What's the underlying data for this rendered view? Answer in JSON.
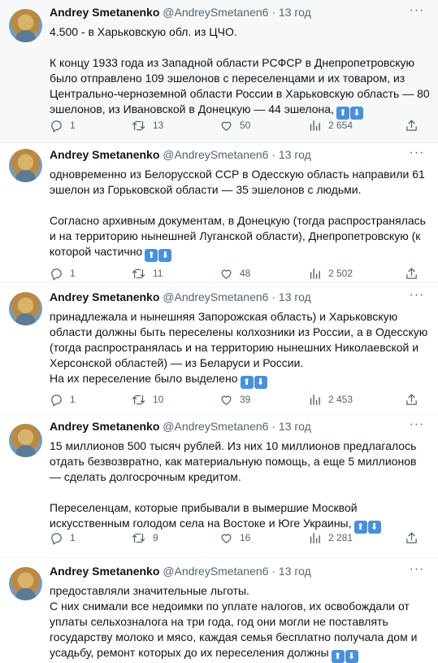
{
  "author": {
    "name": "Andrey Smetanenko",
    "handle": "@AndreySmetanen6"
  },
  "tweets": [
    {
      "time": "13 год",
      "paragraphs": [
        "4.500 - в Харьковскую обл. из ЦЧО.",
        "К концу 1933 года из Западной области РСФСР в Днепропетровскую было отправлено 109 эшелонов с переселенцами и их товаром, из Центрально-черноземной области России в Харьковскую область — 80 эшелонов, из Ивановской в Донецкую — 44 эшелона,"
      ],
      "replies": "1",
      "retweets": "13",
      "likes": "50",
      "views": "2 654"
    },
    {
      "time": "13 год",
      "paragraphs": [
        "одновременно из Белорусской ССР в Одесскую область направили 61 эшелон из Горьковской области — 35 эшелонов с людьми.",
        "Согласно архивным документам, в Донецкую (тогда распространялась и на территорию нынешней Луганской области), Днепропетровскую (к которой частично"
      ],
      "replies": "1",
      "retweets": "11",
      "likes": "48",
      "views": "2 502"
    },
    {
      "time": "13 год",
      "paragraphs": [
        "принадлежала и нынешняя Запорожская область) и Харьковскую области должны быть переселены колхозники из России, а в Одесскую (тогда распространялась и на территорию нынешних Николаевской и Херсонской областей) — из Беларуси и России.",
        "На их переселение было выделено"
      ],
      "replies": "1",
      "retweets": "10",
      "likes": "39",
      "views": "2 453"
    },
    {
      "time": "13 год",
      "paragraphs": [
        "15 миллионов 500 тысяч рублей. Из них 10 миллионов предлагалось отдать безвозвратно, как материальную помощь, а еще 5 миллионов — сделать долгосрочным кредитом.",
        "Переселенцам, которые прибывали в вымершие Москвой искусственным голодом села на Востоке и Юге Украины,"
      ],
      "replies": "1",
      "retweets": "9",
      "likes": "16",
      "views": "2 281"
    },
    {
      "time": "13 год",
      "paragraphs": [
        "предоставляли значительные льготы.",
        "С них снимали все недоимки по уплате налогов, их освобождали от уплаты сельхозналога на три года, год они могли не поставлять государству молоко и мясо, каждая семья бесплатно получала дом и усадьбу, ремонт которых до их переселения должны"
      ]
    }
  ],
  "icons": {
    "reply": "reply-icon",
    "retweet": "retweet-icon",
    "like": "heart-icon",
    "views": "views-icon",
    "share": "share-icon",
    "more": "more-icon",
    "arrows": "up-down-arrows-icon"
  },
  "colors": {
    "highlight_bg": "#f7f9f9",
    "muted": "#536471",
    "arrow_badge": "#4a90d9"
  }
}
